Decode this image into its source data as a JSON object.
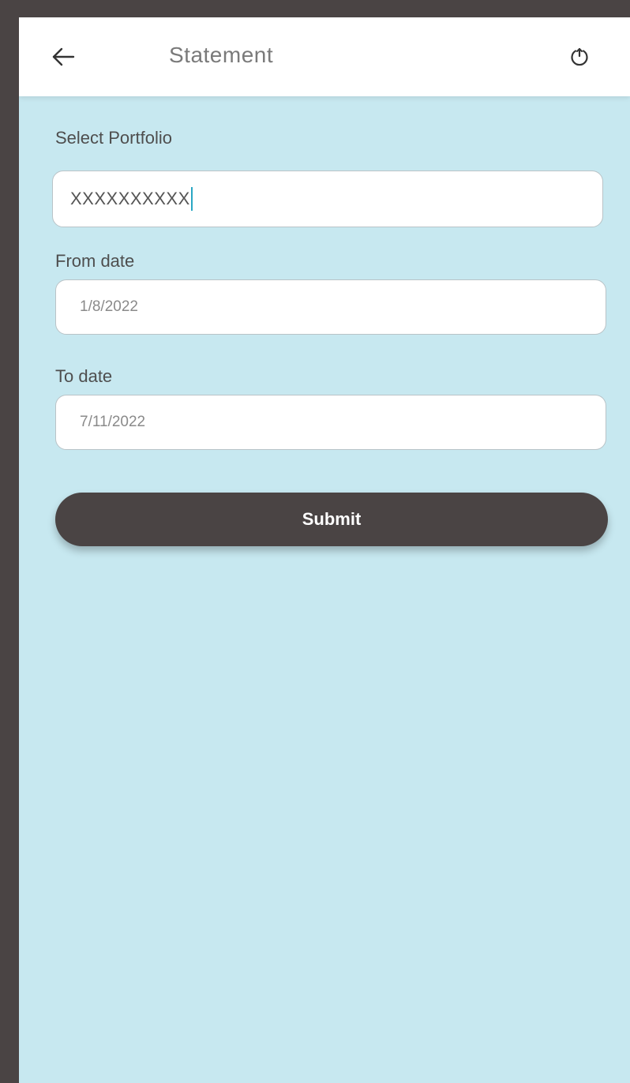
{
  "header": {
    "title": "Statement",
    "back_icon": "back-arrow-icon",
    "power_icon": "power-icon"
  },
  "form": {
    "portfolio": {
      "label": "Select Portfolio",
      "value": "XXXXXXXXXX"
    },
    "from_date": {
      "label": "From date",
      "value": "1/8/2022"
    },
    "to_date": {
      "label": "To date",
      "value": "7/11/2022"
    },
    "submit_label": "Submit"
  },
  "colors": {
    "background": "#c7e8f0",
    "frame": "#4a4444",
    "appbar": "#ffffff",
    "button": "#4a4444",
    "caret": "#2aa7c4"
  }
}
